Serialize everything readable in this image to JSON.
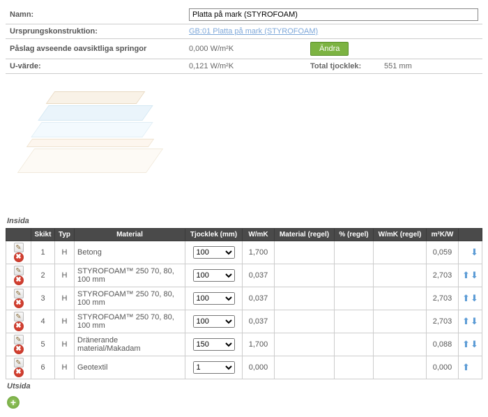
{
  "labels": {
    "name": "Namn:",
    "origin": "Ursprungskonstruktion:",
    "paslag": "Påslag avseende oavsiktliga springor",
    "uvarde": "U-värde:",
    "total_tjocklek": "Total tjocklek:",
    "andra": "Ändra",
    "insida": "Insida",
    "utsida": "Utsida"
  },
  "values": {
    "name": "Platta på mark (STYROFOAM)",
    "origin": "GB:01 Platta på mark (STYROFOAM)",
    "paslag": "0,000 W/m²K",
    "uvarde": "0,121 W/m²K",
    "total_tjocklek": "551 mm"
  },
  "columns": {
    "skikt": "Skikt",
    "typ": "Typ",
    "material": "Material",
    "tjocklek": "Tjocklek (mm)",
    "wmk": "W/mK",
    "material_regel": "Material (regel)",
    "pct_regel": "% (regel)",
    "wmk_regel": "W/mK (regel)",
    "m2kw": "m²K/W"
  },
  "rows": [
    {
      "skikt": "1",
      "typ": "H",
      "material": "Betong",
      "tjocklek": "100",
      "wmk": "1,700",
      "m2kw": "0,059",
      "up": false,
      "down": true
    },
    {
      "skikt": "2",
      "typ": "H",
      "material": "STYROFOAM™ 250 70, 80, 100 mm",
      "tjocklek": "100",
      "wmk": "0,037",
      "m2kw": "2,703",
      "up": true,
      "down": true
    },
    {
      "skikt": "3",
      "typ": "H",
      "material": "STYROFOAM™ 250 70, 80, 100 mm",
      "tjocklek": "100",
      "wmk": "0,037",
      "m2kw": "2,703",
      "up": true,
      "down": true
    },
    {
      "skikt": "4",
      "typ": "H",
      "material": "STYROFOAM™ 250 70, 80, 100 mm",
      "tjocklek": "100",
      "wmk": "0,037",
      "m2kw": "2,703",
      "up": true,
      "down": true
    },
    {
      "skikt": "5",
      "typ": "H",
      "material": "Dränerande material/Makadam",
      "tjocklek": "150",
      "wmk": "1,700",
      "m2kw": "0,088",
      "up": true,
      "down": true
    },
    {
      "skikt": "6",
      "typ": "H",
      "material": "Geotextil",
      "tjocklek": "1",
      "wmk": "0,000",
      "m2kw": "0,000",
      "up": true,
      "down": false
    }
  ]
}
